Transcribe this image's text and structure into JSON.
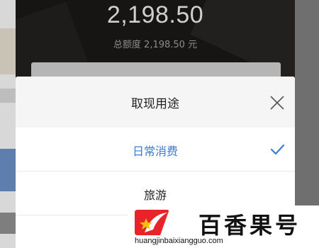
{
  "account": {
    "available_amount": "2,198.50",
    "total_limit": "总额度 2,198.50 元"
  },
  "sheet": {
    "title": "取现用途",
    "options": [
      {
        "label": "日常消费",
        "selected": true
      },
      {
        "label": "旅游",
        "selected": false
      },
      {
        "label": "",
        "selected": false
      }
    ]
  },
  "watermark": {
    "brand": "百香果号",
    "url": "huangjinbaixiangguo.com"
  },
  "colors": {
    "selected": "#3a7bd5",
    "hero_bg": "#171514",
    "logo_red": "#e8242a",
    "logo_yellow": "#f4c20d"
  },
  "icons": {
    "close": "close-icon",
    "check": "check-icon",
    "logo": "star-swoosh-logo"
  }
}
